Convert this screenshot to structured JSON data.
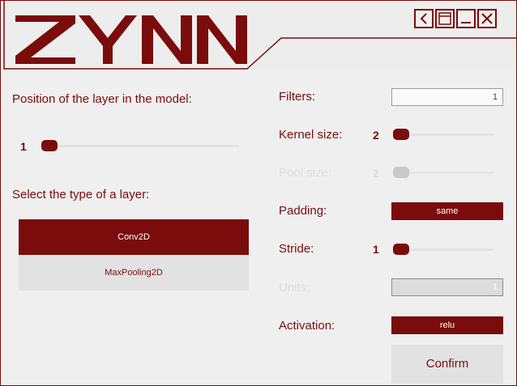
{
  "app": {
    "logo_text": "ZYNN"
  },
  "window_controls": {
    "icons": [
      "back-icon",
      "window-icon",
      "minimize-icon",
      "close-icon"
    ]
  },
  "left": {
    "position_label": "Position of the layer in the model:",
    "position_value": "1",
    "type_label": "Select the type of a layer:",
    "layer_types": [
      {
        "label": "Conv2D",
        "selected": true
      },
      {
        "label": "MaxPooling2D",
        "selected": false
      }
    ]
  },
  "right": {
    "filters_label": "Filters:",
    "filters_value": "1",
    "kernel_label": "Kernel size:",
    "kernel_value": "2",
    "pool_label": "Pool size:",
    "pool_value": "2",
    "padding_label": "Padding:",
    "padding_value": "same",
    "stride_label": "Stride:",
    "stride_value": "1",
    "units_label": "Units:",
    "units_value": "1",
    "activation_label": "Activation:",
    "activation_value": "relu",
    "confirm_label": "Confirm"
  },
  "colors": {
    "accent": "#7a0c0c",
    "background": "#efefef",
    "disabled": "#dcdcdc"
  }
}
